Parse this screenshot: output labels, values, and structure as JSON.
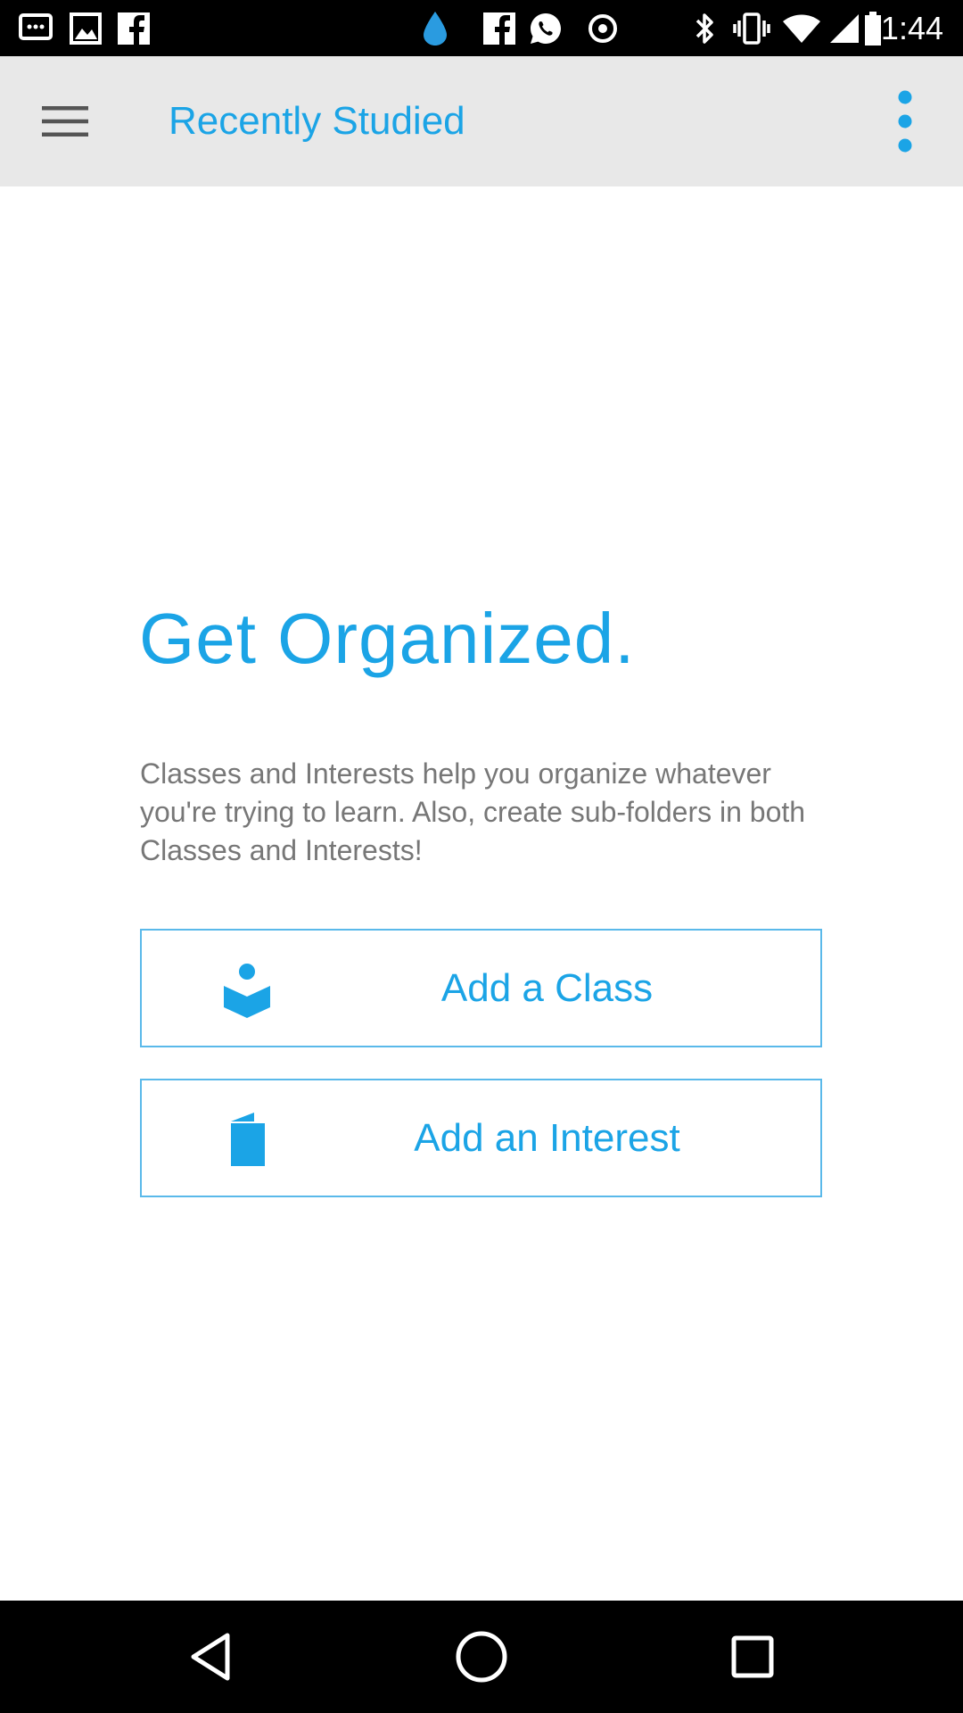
{
  "status_bar": {
    "time": "1:44",
    "left_icons": [
      "notification-icon",
      "image-icon",
      "facebook-icon",
      "water-drop-icon",
      "facebook-icon",
      "whatsapp-icon",
      "circle-icon"
    ],
    "right_icons": [
      "bluetooth-icon",
      "vibrate-icon",
      "wifi-icon",
      "signal-icon",
      "battery-icon"
    ]
  },
  "app_bar": {
    "title": "Recently Studied",
    "menu_icon": "hamburger-menu-icon",
    "more_icon": "more-vertical-icon"
  },
  "main": {
    "heading": "Get Organized.",
    "description": "Classes and Interests help you organize whatever you're trying to learn. Also, create sub-folders in both Classes and Interests!",
    "add_class_label": "Add a Class",
    "add_interest_label": "Add an Interest"
  },
  "nav_bar": {
    "icons": [
      "back-icon",
      "home-icon",
      "recents-icon"
    ]
  },
  "colors": {
    "accent": "#1ba4e6",
    "app_bar_bg": "#e8e8e8",
    "body_text": "#777777"
  }
}
